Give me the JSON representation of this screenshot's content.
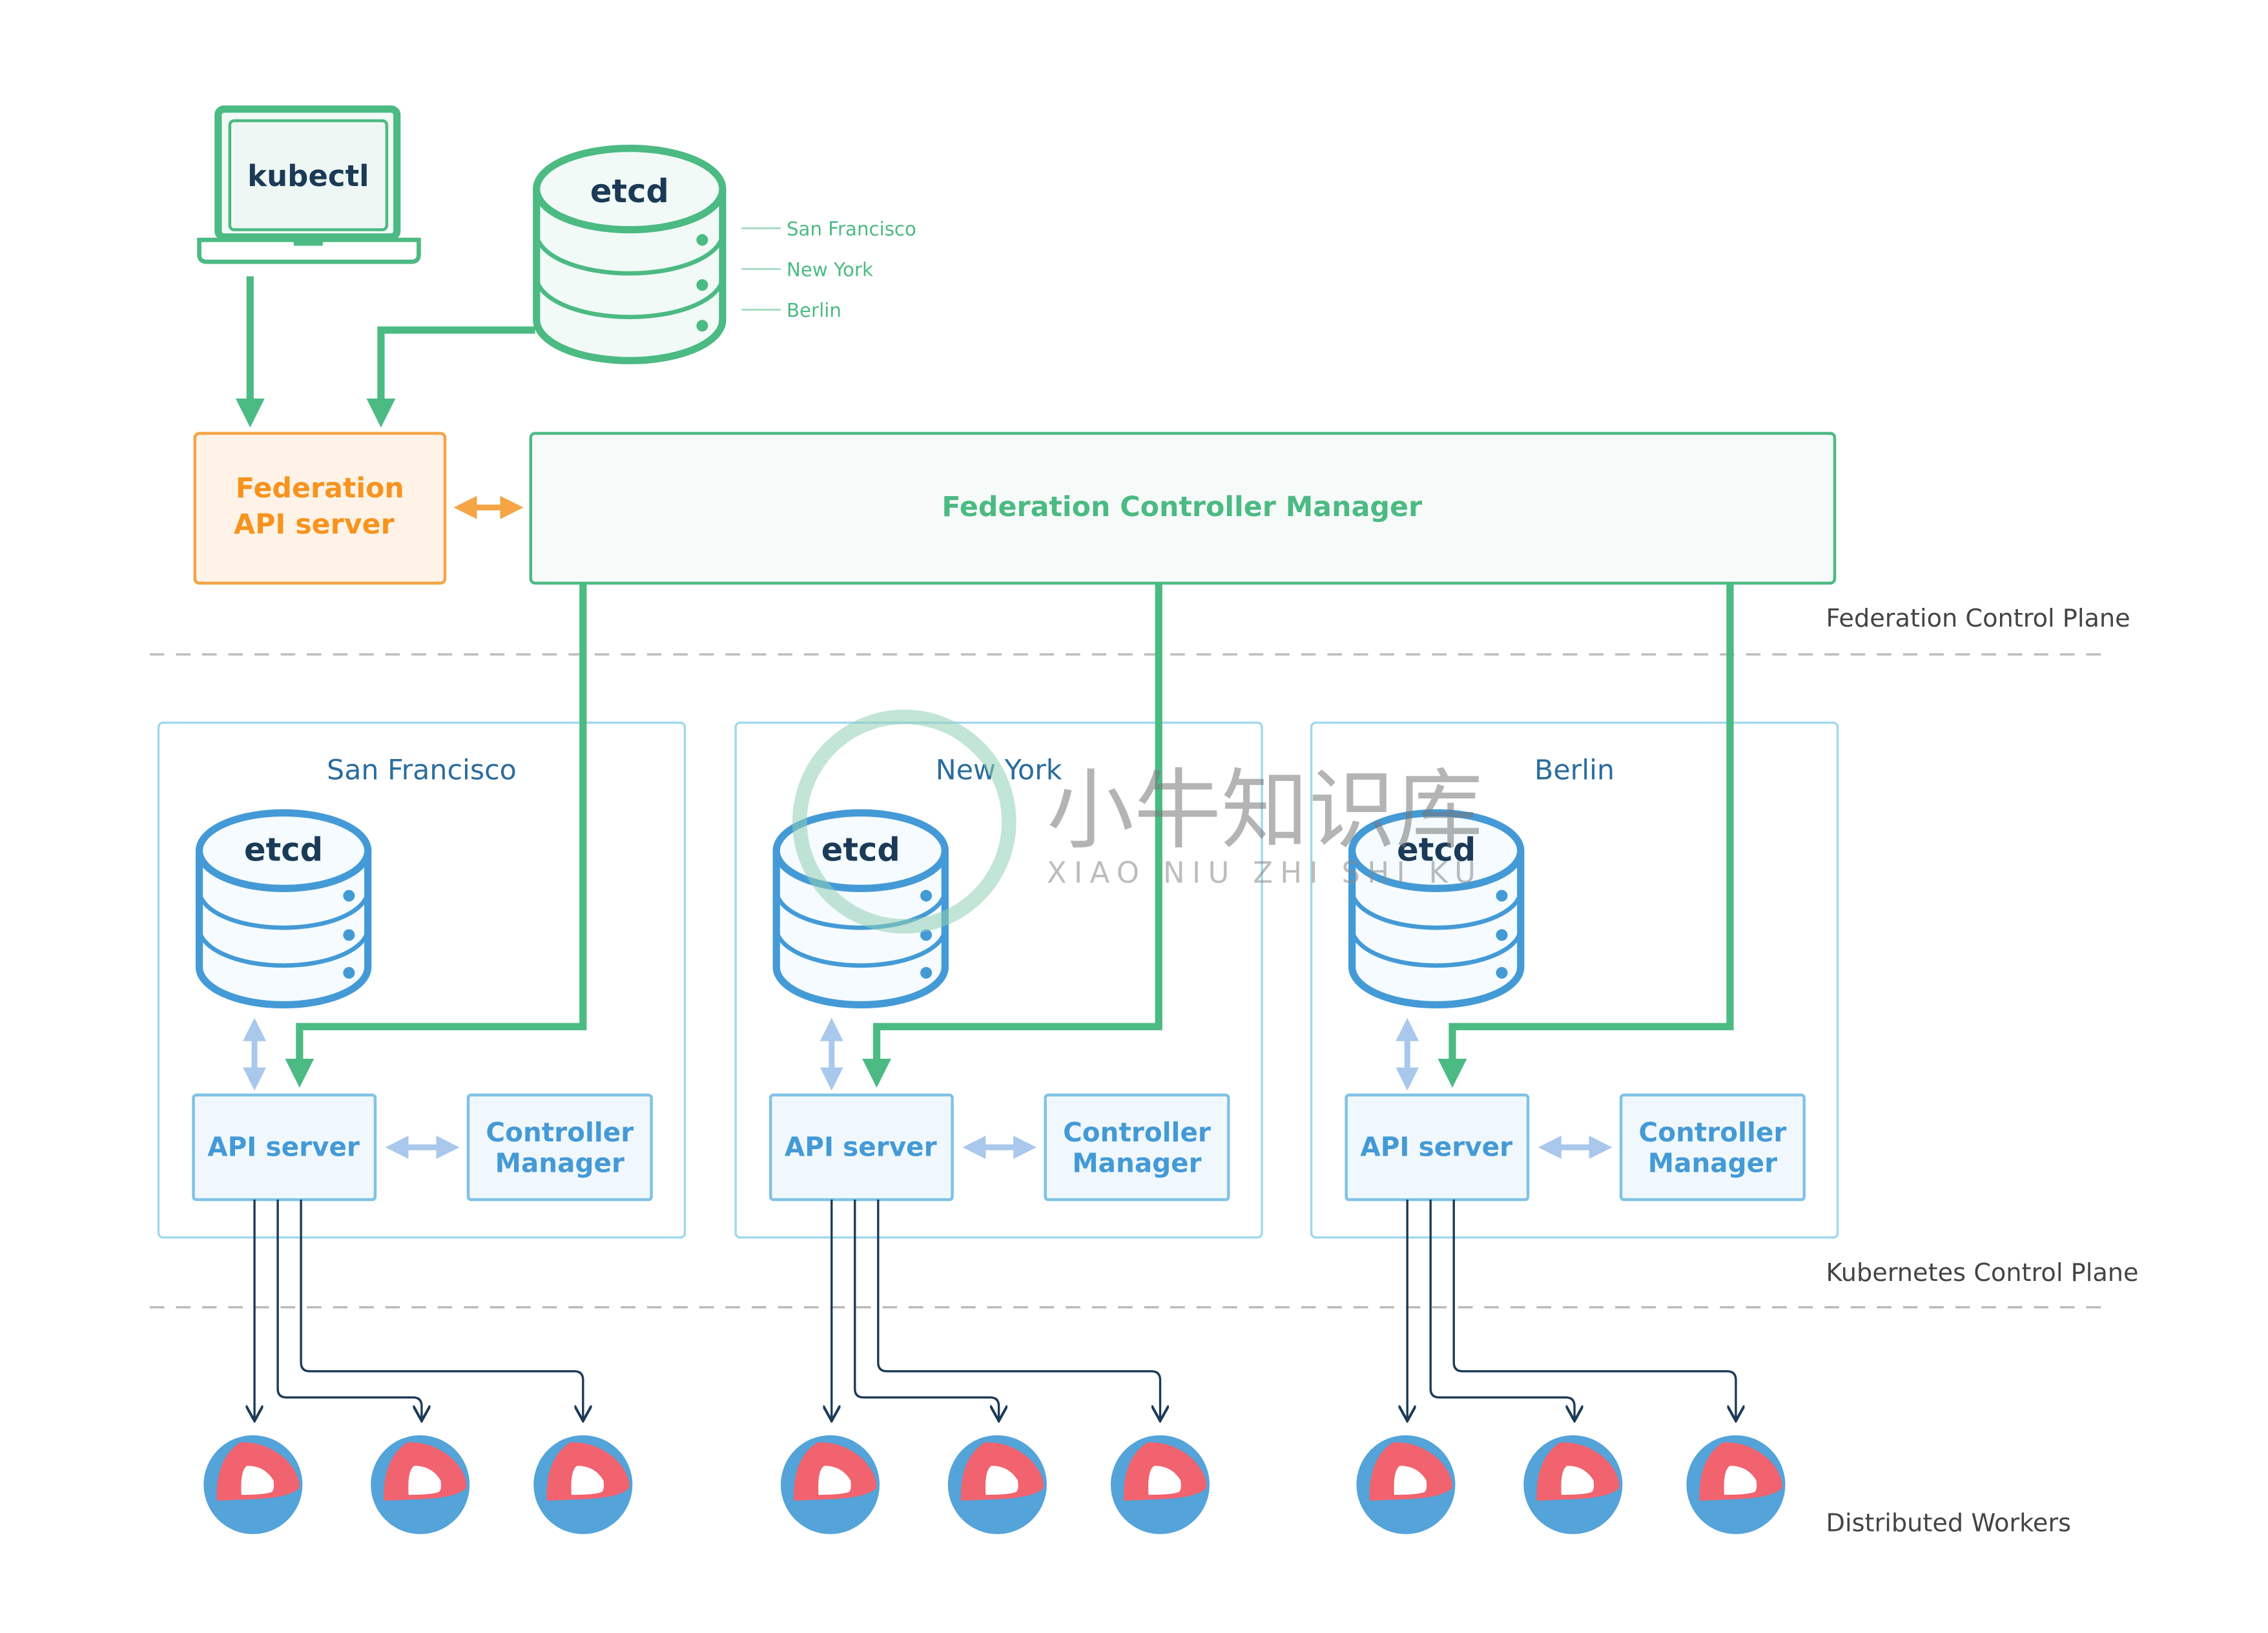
{
  "client": {
    "label": "kubectl"
  },
  "federation_etcd": {
    "label": "etcd",
    "replicas": [
      "San Francisco",
      "New York",
      "Berlin"
    ]
  },
  "federation_api_server": {
    "line1": "Federation",
    "line2": "API server"
  },
  "federation_controller_manager": {
    "label": "Federation Controller Manager"
  },
  "zones": {
    "federation_control_plane": "Federation Control Plane",
    "kubernetes_control_plane": "Kubernetes Control Plane",
    "distributed_workers": "Distributed Workers"
  },
  "clusters": [
    {
      "name": "San Francisco",
      "etcd": "etcd",
      "api_server": "API server",
      "controller_manager": [
        "Controller",
        "Manager"
      ],
      "workers": 3
    },
    {
      "name": "New York",
      "etcd": "etcd",
      "api_server": "API server",
      "controller_manager": [
        "Controller",
        "Manager"
      ],
      "workers": 3
    },
    {
      "name": "Berlin",
      "etcd": "etcd",
      "api_server": "API server",
      "controller_manager": [
        "Controller",
        "Manager"
      ],
      "workers": 3
    }
  ],
  "watermark": {
    "text": "小牛知识库",
    "subtext": "XIAO NIU ZHI SHI KU"
  },
  "colors": {
    "green": "#4cba83",
    "orange": "#f5a446",
    "orange_text": "#f7931e",
    "blue": "#449ad6",
    "light_blue": "#a9c8ec",
    "cluster_border": "#9fd8ec",
    "dark": "#1b3a57",
    "worker_red": "#f1636e",
    "gray_text": "#444444"
  }
}
